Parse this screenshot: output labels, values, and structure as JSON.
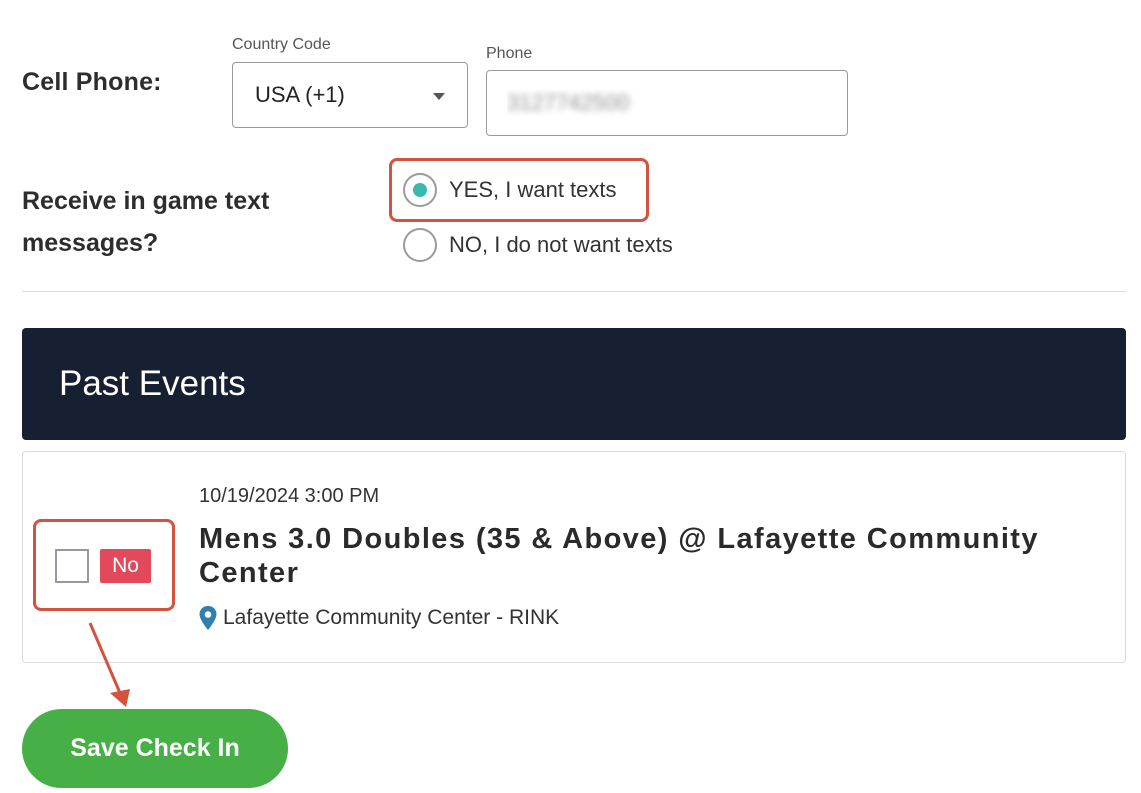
{
  "cell_phone": {
    "label": "Cell Phone:",
    "country_code_caption": "Country Code",
    "country_code_value": "USA (+1)",
    "phone_caption": "Phone",
    "phone_value": "3127742500"
  },
  "texts": {
    "label": "Receive in game text messages?",
    "options": [
      {
        "label": "YES, I want texts",
        "selected": true
      },
      {
        "label": "NO, I do not want texts",
        "selected": false
      }
    ]
  },
  "past_events": {
    "title": "Past Events",
    "events": [
      {
        "datetime": "10/19/2024 3:00 PM",
        "title": "Mens 3.0 Doubles (35 & Above) @ Lafayette Community Center",
        "location": "Lafayette Community Center - RINK",
        "checked_in": false,
        "status_badge": "No"
      }
    ]
  },
  "actions": {
    "save_label": "Save Check In"
  },
  "colors": {
    "header_bg": "#172033",
    "radio_accent": "#39b8b0",
    "badge_no": "#e2495a",
    "save_button": "#46b046",
    "highlight": "#d2533f"
  },
  "icons": {
    "location": "map-pin-icon",
    "dropdown": "caret-down-icon"
  }
}
